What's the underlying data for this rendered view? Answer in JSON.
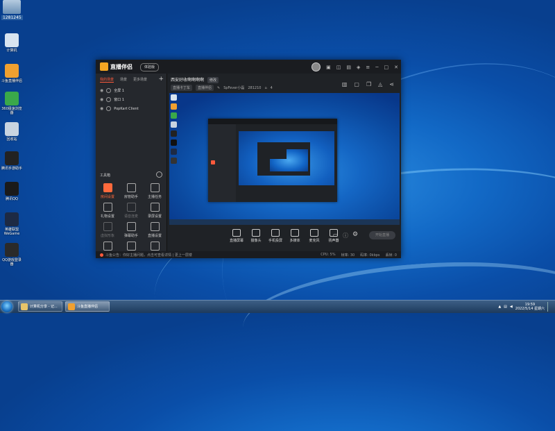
{
  "desktop": {
    "corner_label": "1281245",
    "icons": [
      {
        "label": "计算机",
        "icon": "computer-icon",
        "color": "#d8e4f0"
      },
      {
        "label": "斗鱼直播伴侣",
        "icon": "douyu-icon",
        "color": "#f0a030"
      },
      {
        "label": "360极速浏览器",
        "icon": "browser-360-icon",
        "color": "#3aa84a"
      },
      {
        "label": "回收站",
        "icon": "recycle-bin-icon",
        "color": "#c8d4e0"
      },
      {
        "label": "腾讯手游助手",
        "icon": "tencent-assistant-icon",
        "color": "#222222"
      },
      {
        "label": "腾讯QQ",
        "icon": "qq-icon",
        "color": "#1a1a1a"
      },
      {
        "label": "英雄联盟WeGame",
        "icon": "wegame-icon",
        "color": "#1d2a44"
      },
      {
        "label": "QQ游戏登录器",
        "icon": "qq-game-icon",
        "color": "#2a2a2a"
      }
    ]
  },
  "taskbar": {
    "buttons": [
      {
        "label": "计算机分享 - 记...",
        "icon": "folder-icon"
      },
      {
        "label": "斗鱼直播伴侣",
        "icon": "douyu-icon"
      }
    ],
    "time": "19:59",
    "date": "2022/5/14 星期六"
  },
  "app": {
    "title": "直播伴侣",
    "badge": "体验版",
    "accent": "#ff5a3c",
    "left_tabs": [
      "我的场景",
      "场景",
      "更多场景"
    ],
    "scenes": [
      "全屏 1",
      "窗口 1",
      "PopKart Client"
    ],
    "tools_title": "工具箱",
    "tools": [
      {
        "label": "房间设置",
        "hot": true,
        "dim": false
      },
      {
        "label": "房管助手",
        "hot": false,
        "dim": false
      },
      {
        "label": "主播任务",
        "hot": false,
        "dim": false
      },
      {
        "label": "礼物设置",
        "hot": false,
        "dim": false
      },
      {
        "label": "语音连麦",
        "hot": false,
        "dim": true
      },
      {
        "label": "录屏设置",
        "hot": false,
        "dim": false
      },
      {
        "label": "虚拟形象",
        "hot": false,
        "dim": true
      },
      {
        "label": "弹幕助手",
        "hot": false,
        "dim": false
      },
      {
        "label": "直播设置",
        "hot": false,
        "dim": false
      },
      {
        "label": "粉丝团",
        "hot": false,
        "dim": false
      },
      {
        "label": "",
        "hot": false,
        "dim": false
      },
      {
        "label": "",
        "hot": false,
        "dim": false
      }
    ],
    "room_title": "西安好收啊啊啊啊",
    "room_tag": "修改",
    "room_category": "直播卡丁车",
    "room_subcategory": "直播伴侣",
    "room_name": "SpFever小磊",
    "room_id": "281210",
    "room_fans": "4",
    "controls": [
      {
        "label": "直播屏幕",
        "icon": "screen-icon"
      },
      {
        "label": "摄像头",
        "icon": "camera-icon"
      },
      {
        "label": "手机投屏",
        "icon": "phone-cast-icon"
      },
      {
        "label": "多媒体",
        "icon": "media-icon"
      },
      {
        "label": "麦克风",
        "icon": "mic-icon"
      },
      {
        "label": "扬声器",
        "icon": "speaker-icon"
      }
    ],
    "go_live": "开始直播",
    "status_left": "斗鱼公告：你好主播问题，点击可查看详情 | 更上一层楼",
    "status_right": [
      "CPU: 5%",
      "帧率: 30",
      "码率: 0kbps",
      "丢帧: 0"
    ]
  }
}
